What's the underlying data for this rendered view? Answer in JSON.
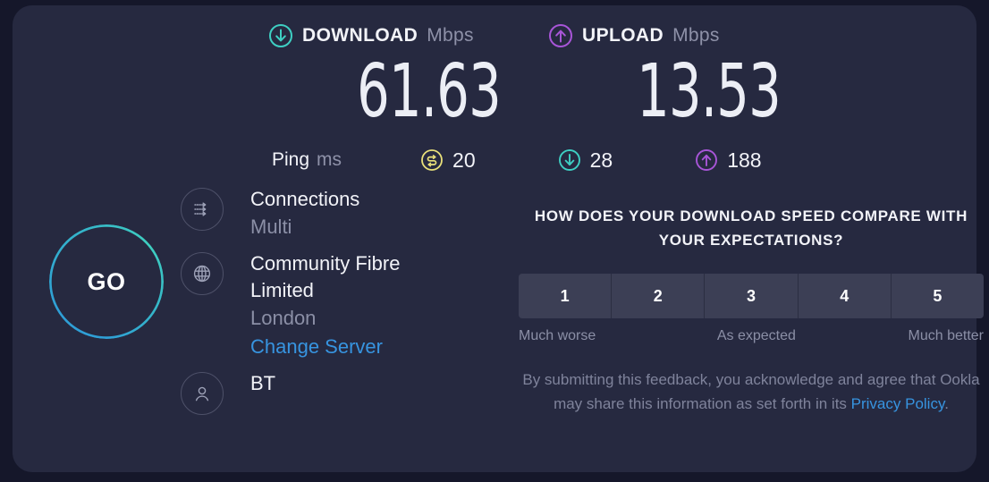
{
  "theme": {
    "page_bg": "#15172a",
    "card_bg": "#262940",
    "download_accent": "#3ecfc3",
    "upload_accent": "#a855d8",
    "idle_accent": "#e9e07a",
    "link": "#3794e0",
    "muted_text": "#8b8fa6"
  },
  "go_button": {
    "label": "GO"
  },
  "speeds": {
    "download": {
      "icon": "download-arrow-icon",
      "label": "DOWNLOAD",
      "unit": "Mbps",
      "value": "61.63"
    },
    "upload": {
      "icon": "upload-arrow-icon",
      "label": "UPLOAD",
      "unit": "Mbps",
      "value": "13.53"
    }
  },
  "ping": {
    "title": "Ping",
    "unit": "ms",
    "metrics": [
      {
        "icon": "idle-latency-icon",
        "value": "20"
      },
      {
        "icon": "download-latency-icon",
        "value": "28"
      },
      {
        "icon": "upload-latency-icon",
        "value": "188"
      }
    ]
  },
  "connection_info": {
    "connections": {
      "icon": "multi-connection-icon",
      "title": "Connections",
      "value": "Multi"
    },
    "server": {
      "icon": "globe-icon",
      "name": "Community Fibre Limited",
      "location": "London",
      "change_link": "Change Server"
    },
    "isp": {
      "icon": "person-icon",
      "name": "BT"
    }
  },
  "feedback": {
    "question": "HOW DOES YOUR DOWNLOAD SPEED COMPARE WITH YOUR EXPECTATIONS?",
    "ratings": [
      "1",
      "2",
      "3",
      "4",
      "5"
    ],
    "scale_low": "Much worse",
    "scale_mid": "As expected",
    "scale_high": "Much better",
    "disclaimer_before": "By submitting this feedback, you acknowledge and agree that Ookla may share this information as set forth in its ",
    "disclaimer_link": "Privacy Policy",
    "disclaimer_after": "."
  }
}
